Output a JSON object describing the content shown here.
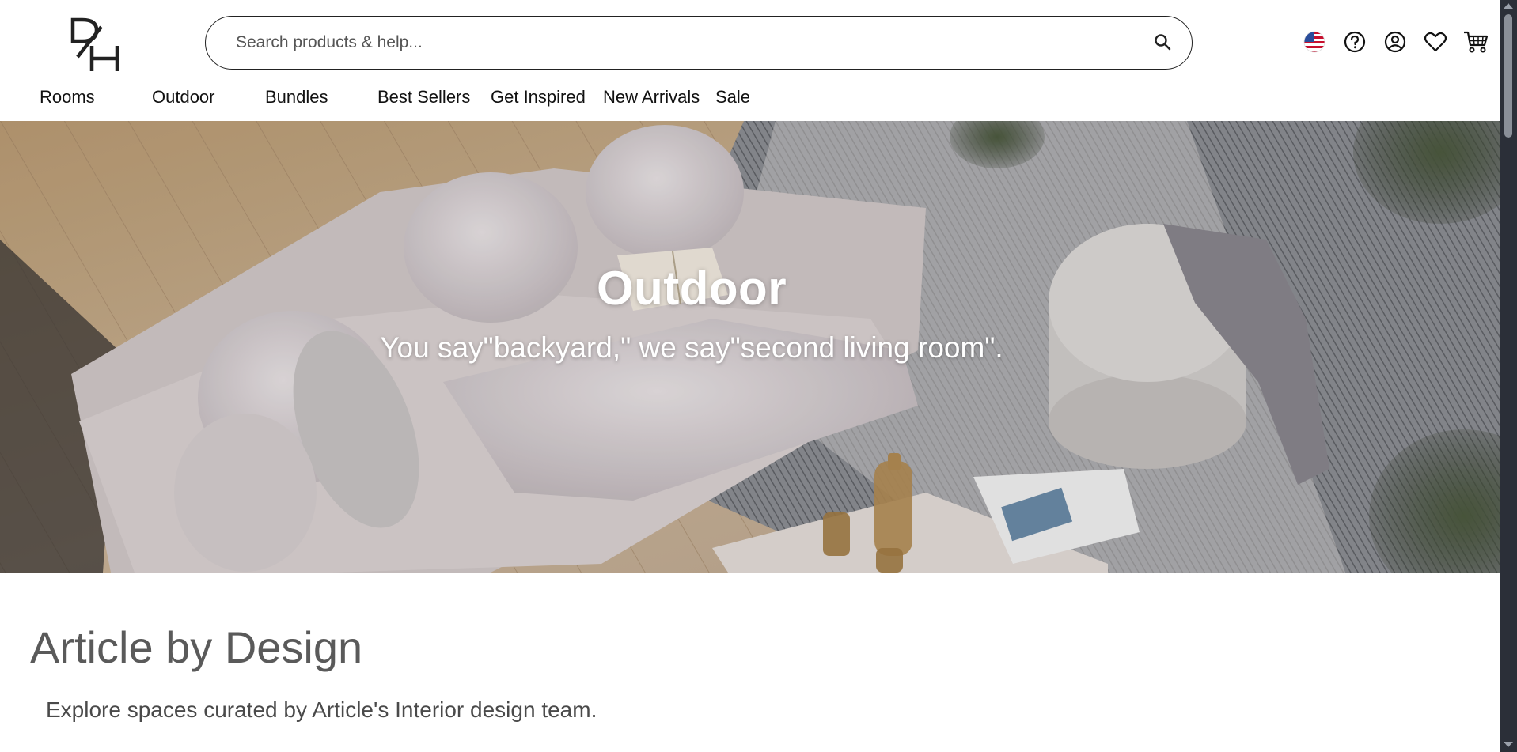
{
  "brand": {
    "logo_text": "DH"
  },
  "search": {
    "placeholder": "Search products & help..."
  },
  "header_icons": [
    "us-flag-icon",
    "help-icon",
    "account-icon",
    "wishlist-heart-icon",
    "cart-icon"
  ],
  "nav": {
    "items": [
      {
        "label": "Rooms"
      },
      {
        "label": "Outdoor"
      },
      {
        "label": "Bundles"
      },
      {
        "label": "Best Sellers"
      },
      {
        "label": "Get Inspired"
      },
      {
        "label": "New Arrivals"
      },
      {
        "label": "Sale"
      }
    ]
  },
  "hero": {
    "title": "Outdoor",
    "subtitle": "You say\"backyard,\" we say\"second living room\"."
  },
  "section": {
    "title": "Article by Design",
    "subtitle": "Explore spaces curated by Article's Interior design team."
  },
  "colors": {
    "text": "#111111",
    "heading_gray": "#5a5a5a",
    "scrollbar_bg": "#2b2f38",
    "flag_red": "#c8102e",
    "flag_blue": "#2a4d9b"
  }
}
